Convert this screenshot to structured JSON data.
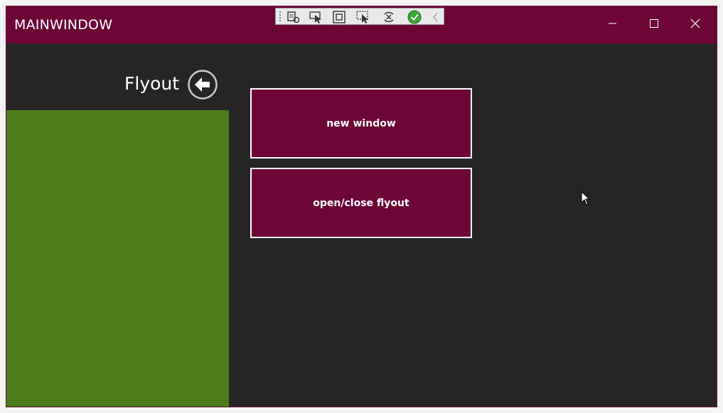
{
  "window": {
    "title": "MAINWINDOW",
    "caption_buttons": {
      "minimize": "minimize-icon",
      "maximize": "maximize-icon",
      "close": "close-icon"
    }
  },
  "devtools_toolbar": {
    "items": [
      "live-visual-tree-icon",
      "select-element-icon",
      "display-layout-adorners-icon",
      "track-focus-icon",
      "hot-reload-icon",
      "check-icon",
      "collapse-chevron-icon"
    ]
  },
  "flyout": {
    "header_title": "Flyout",
    "back_icon": "arrow-left-circle-icon"
  },
  "main": {
    "buttons": [
      {
        "label": "new window"
      },
      {
        "label": "open/close flyout"
      }
    ]
  },
  "colors": {
    "accent": "#6d0636",
    "flyout_background": "#4b7d1a",
    "window_background": "#252525",
    "button_border": "#ffffff"
  }
}
